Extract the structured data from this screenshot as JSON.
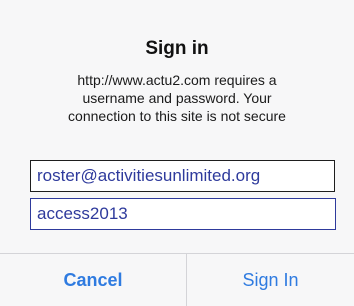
{
  "dialog": {
    "title": "Sign in",
    "message_line1": "http://www.actu2.com requires a",
    "message_line2": "username and password. Your",
    "message_line3": "connection to this site is not secure",
    "username_value": "roster@activitiesunlimited.org",
    "password_value": "access2013",
    "cancel_label": "Cancel",
    "signin_label": "Sign In"
  },
  "colors": {
    "button_text": "#2f7be0",
    "field_text": "#2e3a9c",
    "background": "#f7f7f8"
  }
}
